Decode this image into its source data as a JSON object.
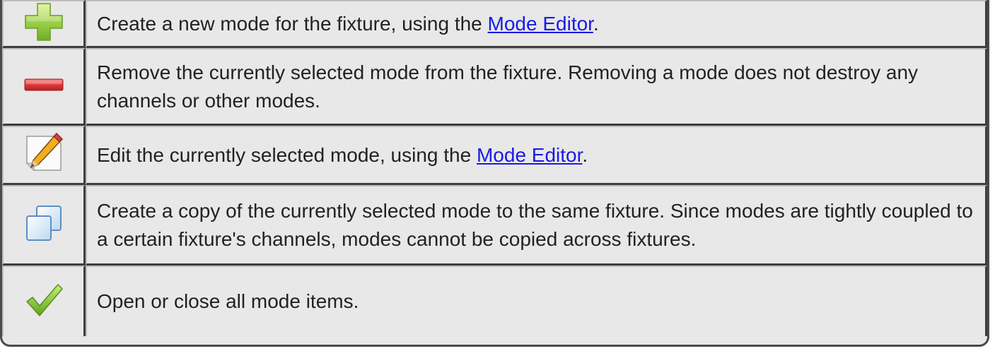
{
  "rows": [
    {
      "icon": "add-mode-icon",
      "text_before": "Create a new mode for the fixture, using the ",
      "link": "Mode Editor",
      "text_after": "."
    },
    {
      "icon": "remove-mode-icon",
      "text": "Remove the currently selected mode from the fixture. Removing a mode does not destroy any channels or other modes."
    },
    {
      "icon": "edit-mode-icon",
      "text_before": "Edit the currently selected mode, using the ",
      "link": "Mode Editor",
      "text_after": "."
    },
    {
      "icon": "copy-mode-icon",
      "text": "Create a copy of the currently selected mode to the same fixture. Since modes are tightly coupled to a certain fixture's channels, modes cannot be copied across fixtures."
    },
    {
      "icon": "expand-collapse-icon",
      "text": "Open or close all mode items."
    }
  ],
  "colors": {
    "link": "#1a1ae6",
    "cell_background": "#e8e8e8",
    "text": "#222222"
  }
}
